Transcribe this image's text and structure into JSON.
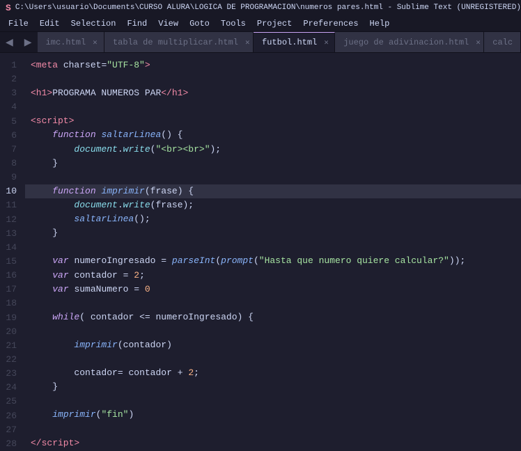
{
  "titlebar": {
    "logo": "S",
    "text": "C:\\Users\\usuario\\Documents\\CURSO ALURA\\LOGICA DE PROGRAMACION\\numeros pares.html - Sublime Text (UNREGISTERED)"
  },
  "menubar": {
    "items": [
      "File",
      "Edit",
      "Selection",
      "Find",
      "View",
      "Goto",
      "Tools",
      "Project",
      "Preferences",
      "Help"
    ]
  },
  "tabs": [
    {
      "label": "imc.html",
      "active": false
    },
    {
      "label": "tabla de multiplicar.html",
      "active": false
    },
    {
      "label": "futbol.html",
      "active": false
    },
    {
      "label": "juego de adivinacion.html",
      "active": false
    },
    {
      "label": "calc",
      "active": false
    }
  ],
  "active_tab": "numeros pares.html",
  "line_numbers": [
    1,
    2,
    3,
    4,
    5,
    6,
    7,
    8,
    9,
    10,
    11,
    12,
    13,
    14,
    15,
    16,
    17,
    18,
    19,
    20,
    21,
    22,
    23,
    24,
    25,
    26,
    27,
    28
  ]
}
